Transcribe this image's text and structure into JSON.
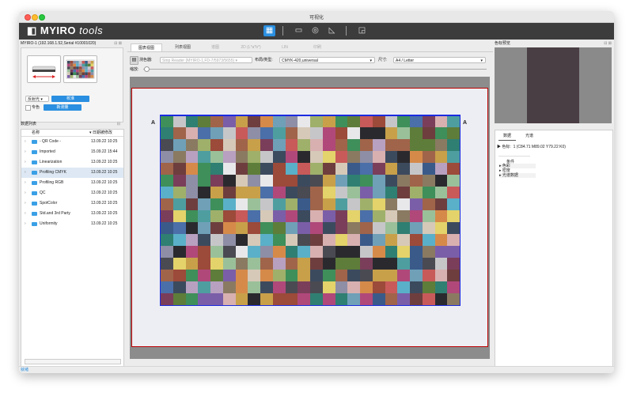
{
  "window": {
    "title": "可视化"
  },
  "brand": {
    "logo": "MYIRO",
    "logo_tools": "tools"
  },
  "toolbar": {
    "buttons": [
      "visualize",
      "measure-window",
      "target",
      "curve",
      "report"
    ]
  },
  "left": {
    "device_header": "MYIRO-1 (192.168.1.52,Serial #10001020)",
    "mode_select": "反射光",
    "calibrate_button": "校准",
    "spot_label": "专色",
    "new_measure_button": "新测量",
    "data_list_header": "数据列表",
    "col_name": "名称",
    "col_date": "日期被修改",
    "rows": [
      {
        "name": "- QR Code -",
        "date": "13.09.22 10:25"
      },
      {
        "name": "Imported",
        "date": "15.09.22 15:44"
      },
      {
        "name": "Linearization",
        "date": "13.09.22 10:25"
      },
      {
        "name": "Profiling CMYK",
        "date": "13.09.22 10:25"
      },
      {
        "name": "Profiling RGB",
        "date": "13.09.22 10:25"
      },
      {
        "name": "QC",
        "date": "13.09.22 10:25"
      },
      {
        "name": "SpotColor",
        "date": "13.09.22 10:25"
      },
      {
        "name": "Std.and 3rd Party",
        "date": "13.09.22 10:25"
      },
      {
        "name": "Uniformity",
        "date": "13.09.22 10:25"
      }
    ]
  },
  "center": {
    "tabs": [
      "图表视图",
      "列表视图",
      "谱图",
      "2D (L*a*b*)",
      "LIN",
      "印刷"
    ],
    "instrument_label": "测色器:",
    "instrument_value": "Strip Reader (MYIRO-1,FD-7/5973/5655)",
    "layout_label": "布局/类型:",
    "layout_value": "CMYK-420,universal",
    "size_label": "尺寸:",
    "size_value": "A4 / Letter",
    "zoom_label": "缩放:",
    "row_label": "A",
    "grid_cols": 24,
    "grid_rows": 16
  },
  "right": {
    "preview_header": "色标预览",
    "swatch_color": "#4a3e45",
    "tab_data": "数据",
    "tab_spectrum": "光谱",
    "patch_label": "色标:",
    "patch_value": "1 (C84.71 M89.02 Y79.22 K0)",
    "tree_header": "条件",
    "tree_items": [
      "色彩",
      "密度",
      "光谱数据"
    ]
  },
  "status": {
    "text": "就绪"
  }
}
